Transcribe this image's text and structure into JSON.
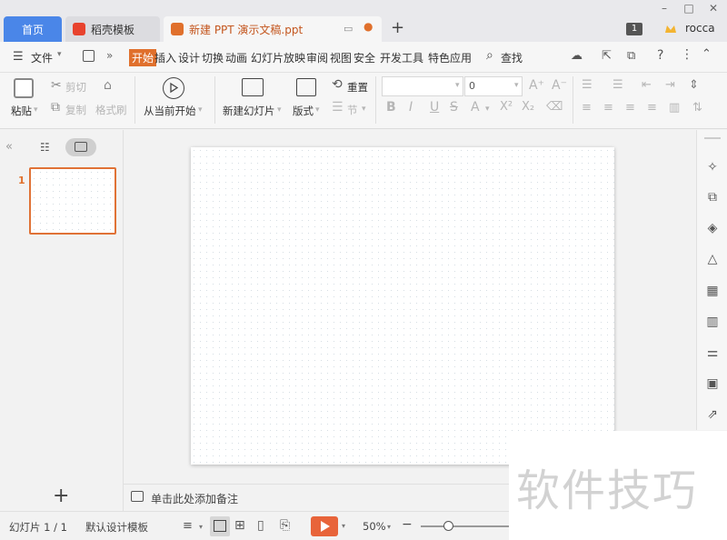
{
  "tabs": {
    "home": "首页",
    "templates": "稻壳模板",
    "document": "新建 PPT 演示文稿.ppt"
  },
  "titlebar": {
    "badge": "1",
    "user": "rocca"
  },
  "menu": {
    "file": "文件",
    "items": [
      "开始",
      "插入",
      "设计",
      "切换",
      "动画",
      "幻灯片放映",
      "审阅",
      "视图",
      "安全",
      "开发工具",
      "特色应用"
    ],
    "search": "查找"
  },
  "ribbon": {
    "paste": "粘贴",
    "cut": "剪切",
    "copy": "复制",
    "format_painter": "格式刷",
    "from_current": "从当前开始",
    "new_slide": "新建幻灯片",
    "layout": "版式",
    "reset": "重置",
    "section": "节",
    "font_size": "0"
  },
  "left_panel": {
    "slide_number": "1"
  },
  "notes": {
    "placeholder": "单击此处添加备注"
  },
  "statusbar": {
    "slide_info": "幻灯片 1 / 1",
    "template": "默认设计模板",
    "zoom": "50%"
  },
  "watermark": {
    "text": "软件技巧"
  },
  "colors": {
    "accent": "#e0702c",
    "home_tab": "#4a86e8",
    "play": "#e8643a"
  }
}
